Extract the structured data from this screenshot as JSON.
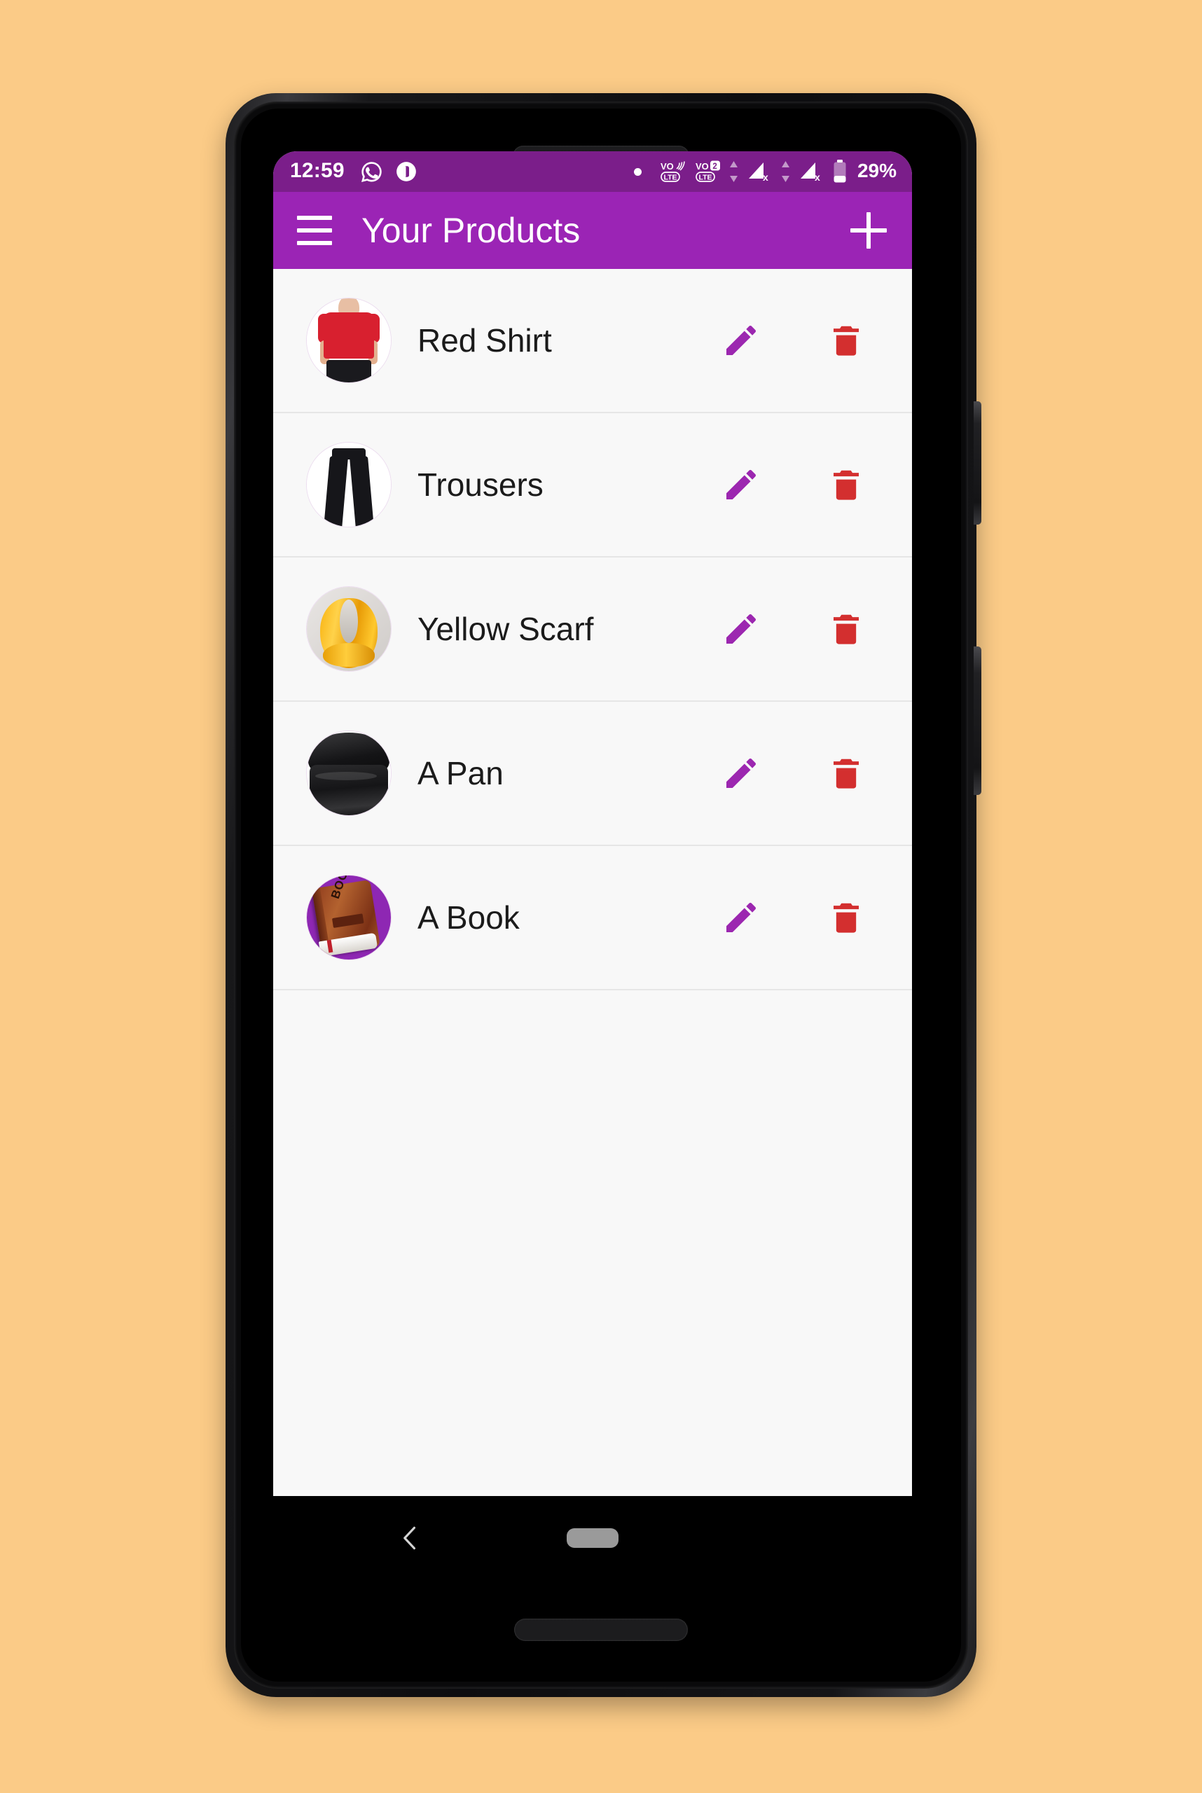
{
  "wallpaper": {
    "background_color": "#FBCB87"
  },
  "device": {
    "frame_color": "#141416",
    "hardware": {
      "earpiece_speaker": "earpiece-speaker",
      "front_camera_main": "front-camera-main",
      "front_camera_secondary": "front-camera-secondary",
      "bottom_speaker": "bottom-speaker-grille",
      "power_button": "power-button",
      "volume_button": "volume-button"
    }
  },
  "status_bar": {
    "background_color": "#7B1E8A",
    "clock": "12:59",
    "battery_percent": "29%",
    "left_icons": [
      "whatsapp-icon",
      "app-notification-icon"
    ],
    "right_icons": [
      "notification-dot",
      "volte-wifi-calling-icon",
      "volte-sim2-icon",
      "data-transfer-arrows-icon",
      "signal-sim1-no-service-icon",
      "data-transfer-arrows-2-icon",
      "signal-sim2-no-service-icon",
      "battery-icon"
    ]
  },
  "app_bar": {
    "background_color": "#9B24B5",
    "title": "Your Products",
    "menu_icon": "hamburger-menu-icon",
    "add_icon": "plus-icon"
  },
  "theme": {
    "accent_purple": "#9B24B5",
    "edit_icon_color": "#9C27B0",
    "delete_icon_color": "#D32F2F",
    "list_background": "#F8F8F8",
    "divider_color": "#E6E6E6",
    "text_color": "#1B1B1B"
  },
  "product_list": {
    "items": [
      {
        "name": "Red Shirt",
        "thumbnail": "red-shirt-photo",
        "edit_label": "edit-icon",
        "delete_label": "delete-icon"
      },
      {
        "name": "Trousers",
        "thumbnail": "trousers-photo",
        "edit_label": "edit-icon",
        "delete_label": "delete-icon"
      },
      {
        "name": "Yellow Scarf",
        "thumbnail": "yellow-scarf-photo",
        "edit_label": "edit-icon",
        "delete_label": "delete-icon"
      },
      {
        "name": "A Pan",
        "thumbnail": "pan-photo",
        "edit_label": "edit-icon",
        "delete_label": "delete-icon"
      },
      {
        "name": "A Book",
        "thumbnail": "book-photo",
        "edit_label": "edit-icon",
        "delete_label": "delete-icon"
      }
    ]
  },
  "navigation_bar": {
    "background_color": "#000000",
    "back_icon": "chevron-left-icon",
    "home_pill": "home-pill-icon"
  },
  "book_art": {
    "spine_text": "BOOK"
  }
}
